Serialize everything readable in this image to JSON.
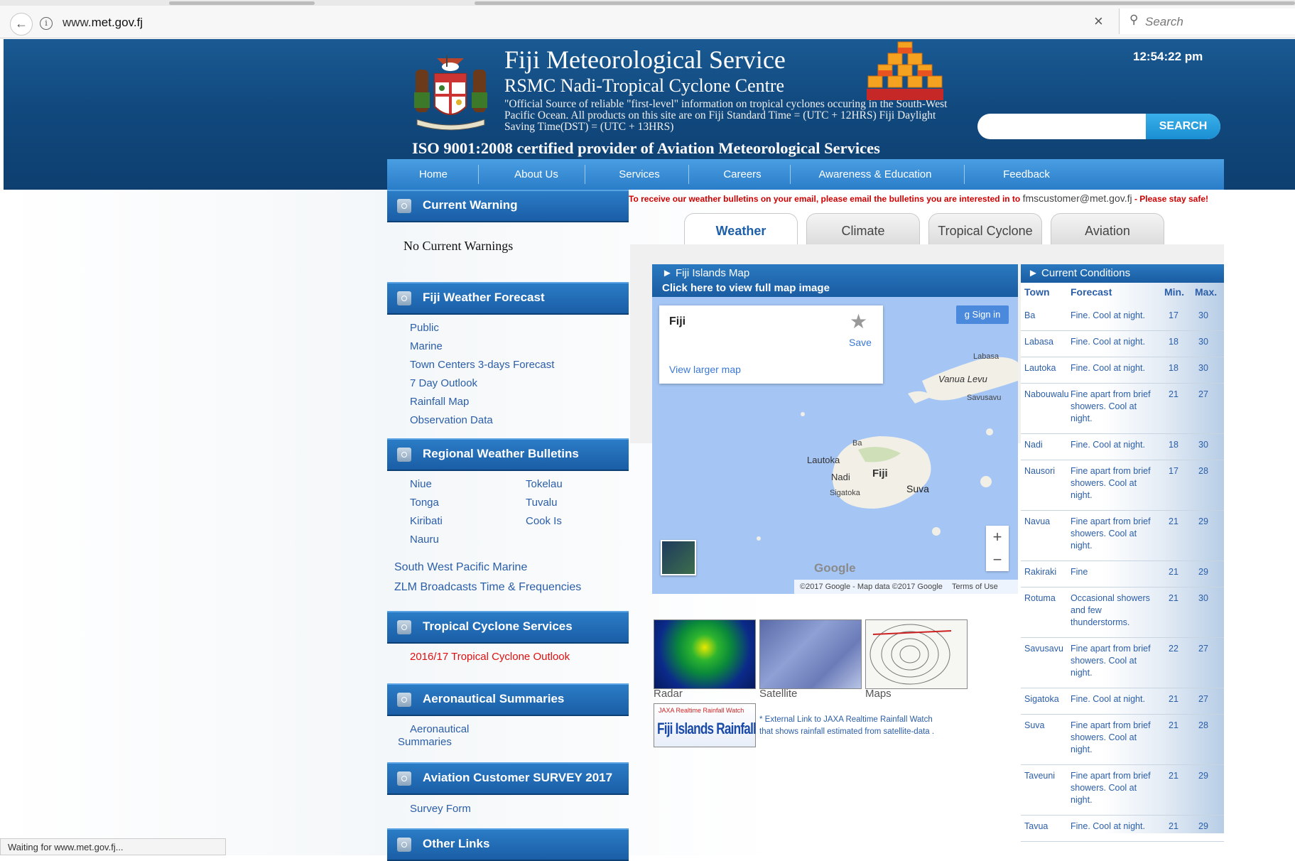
{
  "browser": {
    "url_prefix": "www.",
    "url_domain": "met.gov.fj",
    "search_placeholder": "Search",
    "status_text": "Waiting for www.met.gov.fj...",
    "info_icon": "i"
  },
  "header": {
    "title": "Fiji Meteorological Service",
    "subtitle": "RSMC Nadi-Tropical Cyclone Centre",
    "description": "\"Official Source of reliable \"first-level\" information on tropical cyclones occuring in the South-West Pacific Ocean. All products on this site are on Fiji Standard Time = (UTC + 12HRS) Fiji Daylight Saving Time(DST) = (UTC + 13HRS)",
    "iso": "ISO 9001:2008 certified provider of Aviation Meteorological Services",
    "clock": "12:54:22 pm",
    "search_button": "SEARCH"
  },
  "nav": [
    "Home",
    "About Us",
    "Services",
    "Careers",
    "Awareness & Education",
    "Feedback"
  ],
  "notice": {
    "prefix": "To receive our weather bulletins on your email, please email the bulletins you are interested in to ",
    "email": "fmscustomer@met.gov.fj",
    "suffix": " - Please stay safe!"
  },
  "sidebar": {
    "current_warning": {
      "title": "Current Warning",
      "text": "No Current Warnings"
    },
    "forecast": {
      "title": "Fiji Weather Forecast",
      "links": [
        "Public",
        "Marine",
        "Town Centers 3-days Forecast",
        "7 Day Outlook",
        "Rainfall Map",
        "Observation Data"
      ]
    },
    "regional": {
      "title": "Regional Weather Bulletins",
      "col1": [
        "Niue",
        "Tonga",
        "Kiribati",
        "Nauru"
      ],
      "col2": [
        "Tokelau",
        "Tuvalu",
        "Cook Is"
      ],
      "extra": [
        "South West Pacific Marine",
        "ZLM Broadcasts Time & Frequencies"
      ]
    },
    "cyclone": {
      "title": "Tropical Cyclone Services",
      "link": "2016/17 Tropical Cyclone Outlook"
    },
    "aero": {
      "title": "Aeronautical Summaries",
      "link_line1": "Aeronautical",
      "link_line2": "Summaries"
    },
    "survey": {
      "title": "Aviation Customer SURVEY 2017",
      "link": "Survey Form"
    },
    "other": {
      "title": "Other Links"
    }
  },
  "tabs": [
    "Weather",
    "Climate",
    "Tropical Cyclone",
    "Aviation"
  ],
  "map": {
    "header": "► Fiji Islands Map",
    "link": "Click here to view full map image",
    "card_title": "Fiji",
    "save": "Save",
    "view_larger": "View larger map",
    "sign_in": "Sign in",
    "places": {
      "labasa": "Labasa",
      "vanua_levu": "Vanua Levu",
      "savusavu": "Savusavu",
      "ba": "Ba",
      "lautoka": "Lautoka",
      "nadi": "Nadi",
      "fiji": "Fiji",
      "suva": "Suva",
      "sigatoka": "Sigatoka"
    },
    "google": "Google",
    "attribution": "©2017 Google - Map data ©2017 Google",
    "terms": "Terms of Use",
    "zoom_in": "+",
    "zoom_out": "−"
  },
  "thumbs": {
    "radar": "Radar",
    "satellite": "Satellite",
    "maps": "Maps"
  },
  "jaxa": {
    "banner_top": "JAXA Realtime Rainfall Watch",
    "banner_main": "Fiji Islands Rainfall",
    "text_line1": "* External Link to JAXA Realtime Rainfall Watch",
    "text_line2": "that shows rainfall estimated from satellite-data ."
  },
  "conditions": {
    "title": "► Current Conditions",
    "headers": {
      "town": "Town",
      "forecast": "Forecast",
      "min": "Min.",
      "max": "Max."
    },
    "rows": [
      {
        "town": "Ba",
        "forecast": "Fine. Cool at night.",
        "min": "17",
        "max": "30"
      },
      {
        "town": "Labasa",
        "forecast": "Fine. Cool at night.",
        "min": "18",
        "max": "30"
      },
      {
        "town": "Lautoka",
        "forecast": "Fine. Cool at night.",
        "min": "18",
        "max": "30"
      },
      {
        "town": "Nabouwalu",
        "forecast": "Fine apart from brief showers. Cool at night.",
        "min": "21",
        "max": "27"
      },
      {
        "town": "Nadi",
        "forecast": "Fine. Cool at night.",
        "min": "18",
        "max": "30"
      },
      {
        "town": "Nausori",
        "forecast": "Fine apart from brief showers. Cool at night.",
        "min": "17",
        "max": "28"
      },
      {
        "town": "Navua",
        "forecast": "Fine apart from brief showers. Cool at night.",
        "min": "21",
        "max": "29"
      },
      {
        "town": "Rakiraki",
        "forecast": "Fine",
        "min": "21",
        "max": "29"
      },
      {
        "town": "Rotuma",
        "forecast": "Occasional showers and few thunderstorms.",
        "min": "21",
        "max": "30"
      },
      {
        "town": "Savusavu",
        "forecast": "Fine apart from brief showers. Cool at night.",
        "min": "22",
        "max": "27"
      },
      {
        "town": "Sigatoka",
        "forecast": "Fine. Cool at night.",
        "min": "21",
        "max": "27"
      },
      {
        "town": "Suva",
        "forecast": "Fine apart from brief showers. Cool at night.",
        "min": "21",
        "max": "28"
      },
      {
        "town": "Taveuni",
        "forecast": "Fine apart from brief showers. Cool at night.",
        "min": "21",
        "max": "29"
      },
      {
        "town": "Tavua",
        "forecast": "Fine. Cool at night.",
        "min": "21",
        "max": "29"
      }
    ]
  },
  "colors": {
    "brand_blue": "#1a5ea6",
    "nav_blue": "#3a8ed6",
    "link": "#2b5ea8",
    "alert": "#d00000"
  }
}
